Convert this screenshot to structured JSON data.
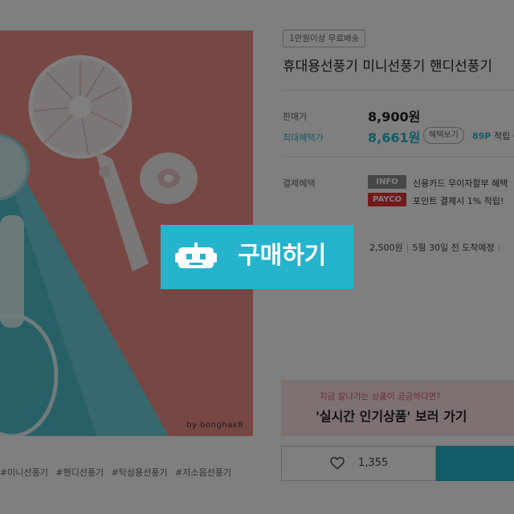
{
  "product": {
    "image_watermark": "by bonghak8",
    "shipping_badge": "1만원이상 무료배송",
    "title": "휴대용선풍기 미니선풍기 핸디선풍기",
    "tags": [
      "#미니선풍기",
      "#핸디선풍기",
      "#탁상용선풍기",
      "#저소음선풍기"
    ]
  },
  "pricing": {
    "sale_label": "판매가",
    "sale_price": "8,900원",
    "benefit_label": "최대혜택가",
    "benefit_price": "8,661원",
    "benefit_button": "혜택보기",
    "points_value": "89P",
    "points_suffix": "적립",
    "points_tail": "(최"
  },
  "payment": {
    "label": "결제혜택",
    "items": [
      {
        "chip": "INFO",
        "chip_color": "#8e8e8e",
        "text": "신용카드 무이자할부 혜택"
      },
      {
        "chip": "PAYCO",
        "chip_color": "#e53335",
        "text": "포인트 결제시 1% 적립!"
      }
    ]
  },
  "delivery": {
    "fee": "2,500원",
    "eta": "5월 30일 전 도착예정",
    "sep": "|"
  },
  "promo": {
    "small": "지금 잘나가는 상품이 궁금하다면?",
    "big": "'실시간 인기상품' 보러 가기"
  },
  "actions": {
    "like_count": "1,355"
  },
  "overlay": {
    "cta_label": "구매하기",
    "cta_color": "#26b3cc"
  }
}
